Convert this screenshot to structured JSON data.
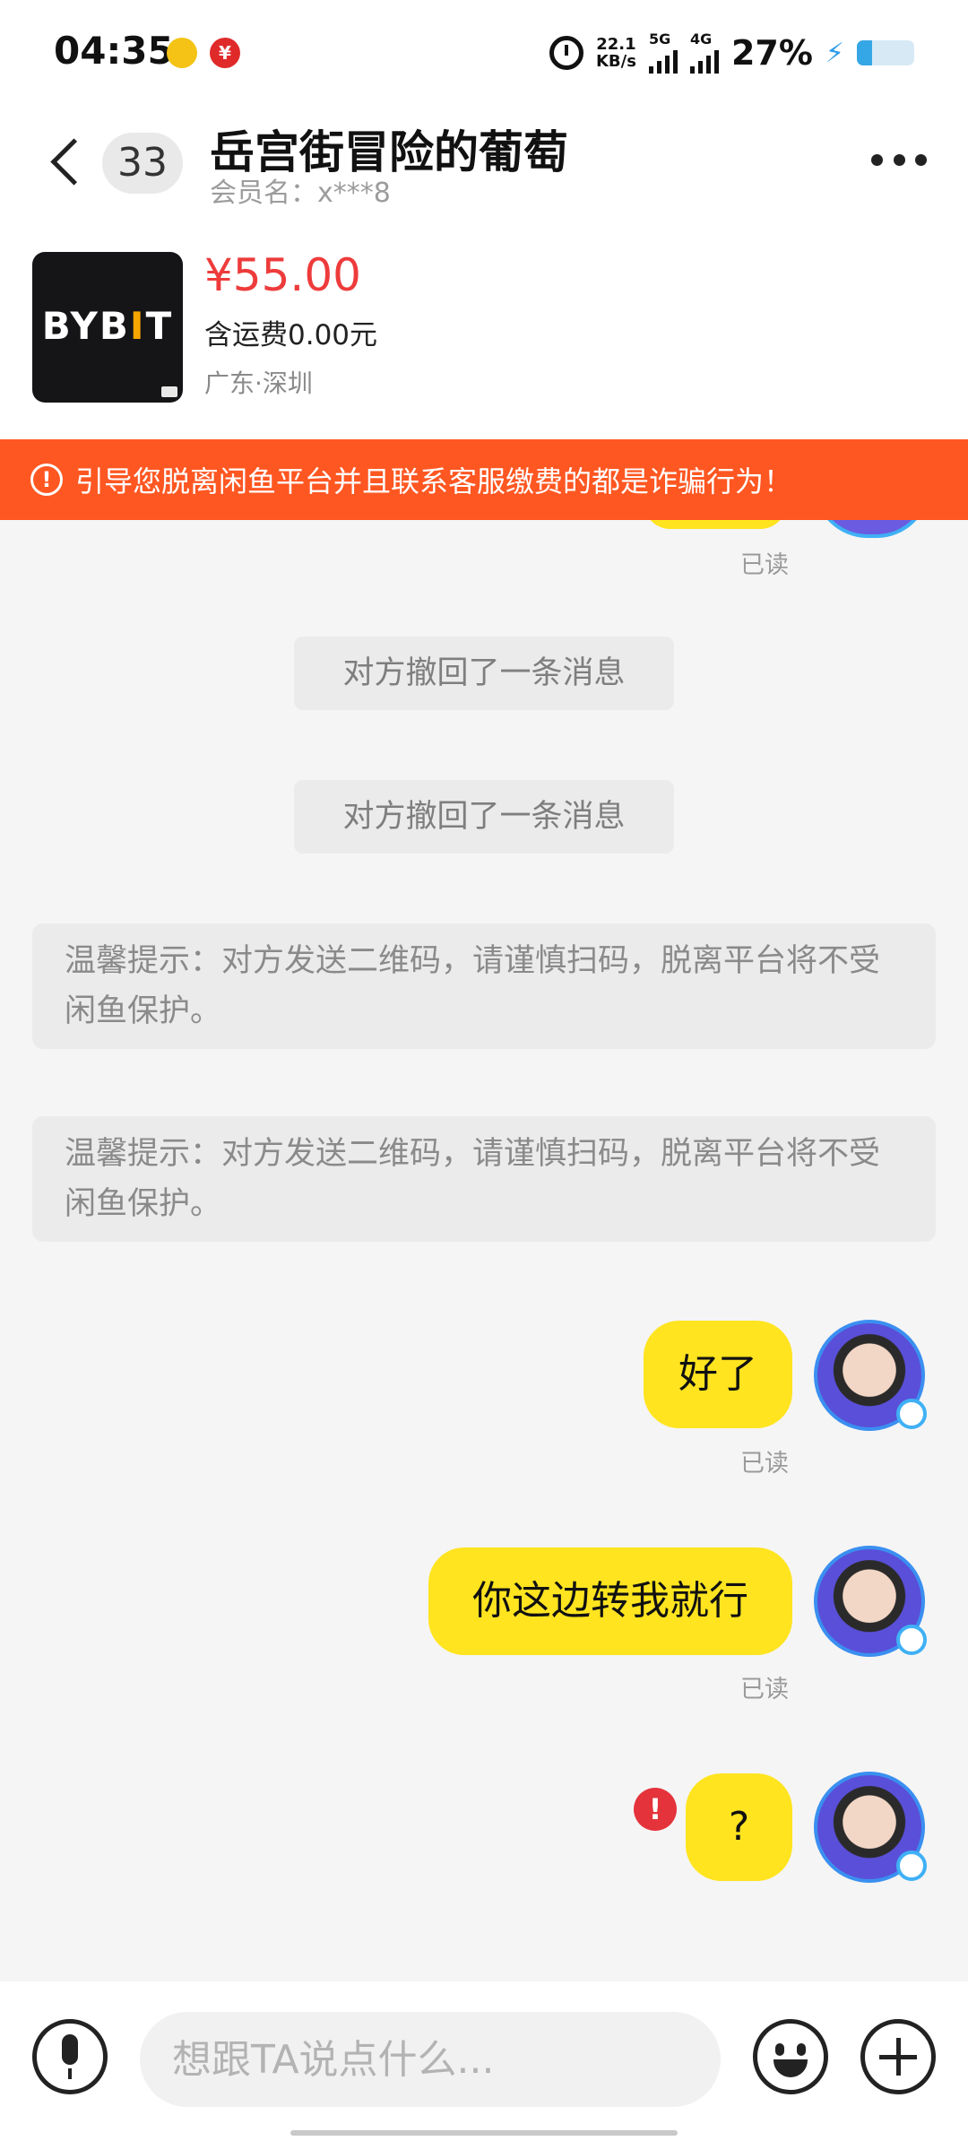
{
  "status_bar": {
    "time": "04:35",
    "net_speed_value": "22.1",
    "net_speed_unit": "KB/s",
    "sim1_label": "5G",
    "sim2_label": "4G",
    "battery_percent_text": "27%",
    "battery_level": 0.27,
    "icons": [
      "app-notification-icon",
      "app-notification-icon",
      "alarm-icon",
      "signal-icon",
      "signal-icon",
      "charging-icon",
      "battery-icon"
    ]
  },
  "header": {
    "unread_count": "33",
    "contact_name": "岳宫街冒险的葡萄",
    "member_name": "会员名：x***8",
    "icons": [
      "back-icon",
      "more-icon"
    ]
  },
  "product": {
    "thumb_logo_a": "BYB",
    "thumb_logo_b": "I",
    "thumb_logo_c": "T",
    "price": "¥55.00",
    "shipping": "含运费0.00元",
    "location": "广东·深圳"
  },
  "warning": {
    "text": "引导您脱离闲鱼平台并且联系客服缴费的都是诈骗行为！"
  },
  "chat": {
    "read_label": "已读",
    "recall_notice": "对方撤回了一条消息",
    "tip_text": "温馨提示：对方发送二维码，请谨慎扫码，脱离平台将不受闲鱼保护。",
    "messages": [
      {
        "text": "好了",
        "status": "已读"
      },
      {
        "text": "你这边转我就行",
        "status": "已读"
      },
      {
        "text": "?",
        "status": "failed"
      }
    ]
  },
  "input": {
    "placeholder": "想跟TA说点什么..."
  },
  "colors": {
    "accent_yellow": "#ffe41f",
    "warning_orange": "#ff5722",
    "price_red": "#ee3b3b",
    "error_red": "#e5333b"
  }
}
